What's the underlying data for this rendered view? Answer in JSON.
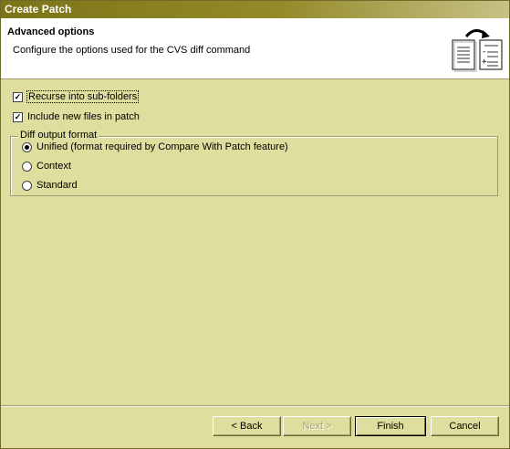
{
  "window": {
    "title": "Create Patch"
  },
  "banner": {
    "title": "Advanced options",
    "description": "Configure the options used for the CVS diff command",
    "image_icon": "patch-documents-icon"
  },
  "options": {
    "recurse": {
      "label": "Recurse into sub-folders",
      "checked": true
    },
    "include_new": {
      "label": "Include new files in patch",
      "checked": true
    }
  },
  "diff_format": {
    "legend": "Diff output format",
    "selected": "Unified",
    "options": [
      {
        "label": "Unified (format required by Compare With Patch feature)",
        "selected": true
      },
      {
        "label": "Context",
        "selected": false
      },
      {
        "label": "Standard",
        "selected": false
      }
    ]
  },
  "buttons": {
    "back": "< Back",
    "next": "Next >",
    "finish": "Finish",
    "cancel": "Cancel"
  },
  "colors": {
    "dialog_bg": "#dede9e",
    "titlebar": "#7c7417",
    "banner_bg": "#ffffff"
  }
}
